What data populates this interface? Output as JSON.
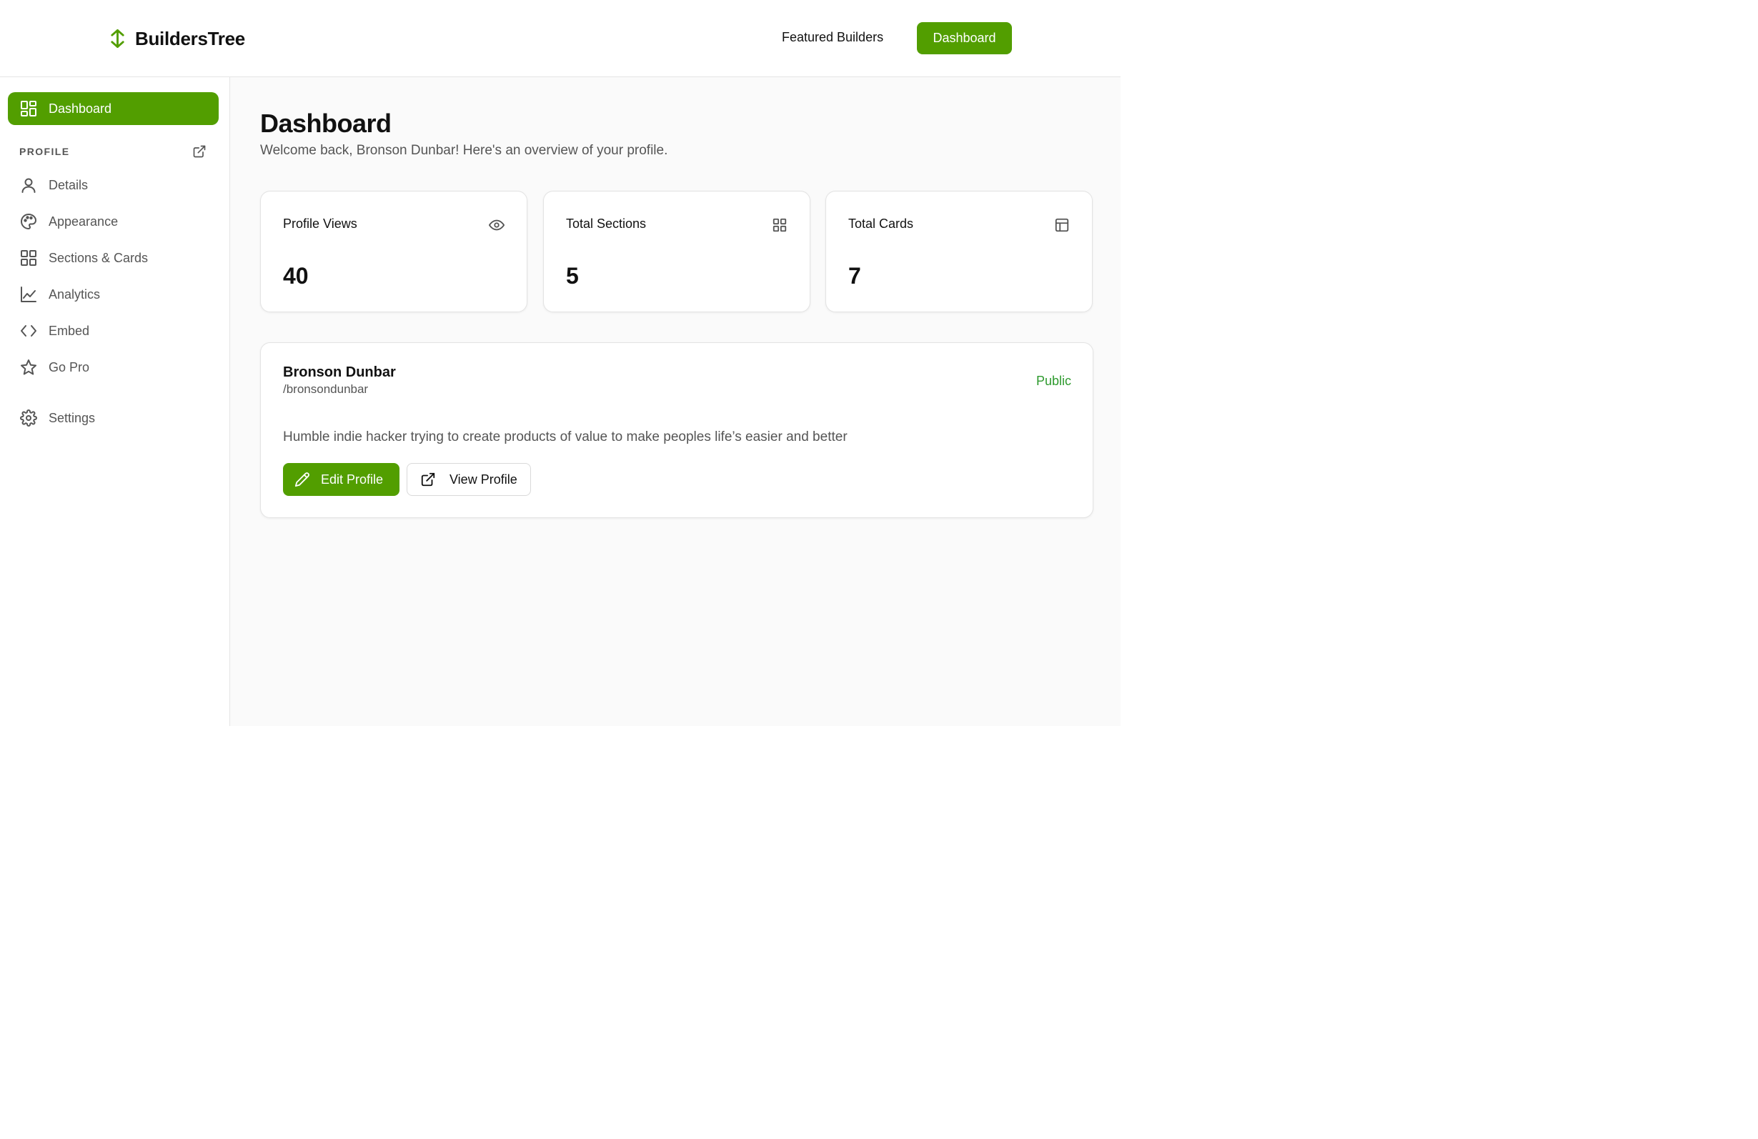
{
  "header": {
    "brand": "BuildersTree",
    "nav_featured": "Featured Builders",
    "nav_dashboard": "Dashboard"
  },
  "sidebar": {
    "active_item": "Dashboard",
    "section_label": "PROFILE",
    "items": [
      {
        "label": "Details",
        "icon": "user-icon"
      },
      {
        "label": "Appearance",
        "icon": "palette-icon"
      },
      {
        "label": "Sections & Cards",
        "icon": "grid-icon"
      },
      {
        "label": "Analytics",
        "icon": "line-chart-icon"
      },
      {
        "label": "Embed",
        "icon": "code-icon"
      },
      {
        "label": "Go Pro",
        "icon": "star-icon"
      }
    ],
    "settings": "Settings"
  },
  "main": {
    "title": "Dashboard",
    "subtitle": "Welcome back, Bronson Dunbar! Here's an overview of your profile.",
    "stats": [
      {
        "label": "Profile Views",
        "value": "40",
        "icon": "eye-icon"
      },
      {
        "label": "Total Sections",
        "value": "5",
        "icon": "grid-icon"
      },
      {
        "label": "Total Cards",
        "value": "7",
        "icon": "layout-icon"
      }
    ],
    "profile": {
      "name": "Bronson Dunbar",
      "handle": "/bronsondunbar",
      "status": "Public",
      "bio": "Humble indie hacker trying to create products of value to make peoples life’s easier and better",
      "edit_label": "Edit Profile",
      "view_label": "View Profile"
    }
  },
  "colors": {
    "accent": "#529e00",
    "public": "#2e9a2e",
    "muted_text": "#555555",
    "border": "#e3e3e3"
  }
}
